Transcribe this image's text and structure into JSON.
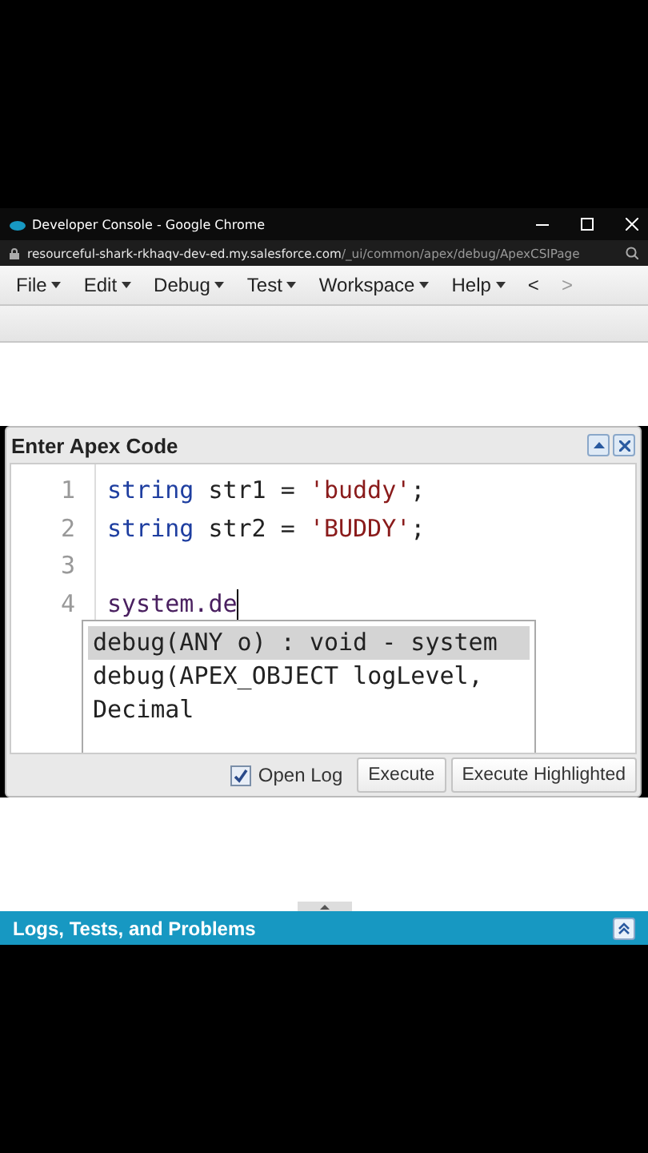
{
  "window": {
    "title": "Developer Console - Google Chrome"
  },
  "address_bar": {
    "host": "resourceful-shark-rkhaqv-dev-ed.my.salesforce.com",
    "path": "/_ui/common/apex/debug/ApexCSIPage"
  },
  "menu": [
    {
      "label": "File",
      "dropdown": true
    },
    {
      "label": "Edit",
      "dropdown": true
    },
    {
      "label": "Debug",
      "dropdown": true
    },
    {
      "label": "Test",
      "dropdown": true
    },
    {
      "label": "Workspace",
      "dropdown": true
    },
    {
      "label": "Help",
      "dropdown": true
    },
    {
      "label": "<",
      "disabled": false
    },
    {
      "label": ">",
      "disabled": true
    }
  ],
  "panel": {
    "title": "Enter Apex Code",
    "lines": [
      {
        "number": "1",
        "tokens": [
          {
            "kind": "keyword",
            "text": "string"
          },
          {
            "kind": "plain",
            "text": " str1 = "
          },
          {
            "kind": "string",
            "text": "'buddy'"
          },
          {
            "kind": "plain",
            "text": ";"
          }
        ]
      },
      {
        "number": "2",
        "tokens": [
          {
            "kind": "keyword",
            "text": "string"
          },
          {
            "kind": "plain",
            "text": " str2 = "
          },
          {
            "kind": "string",
            "text": "'BUDDY'"
          },
          {
            "kind": "plain",
            "text": ";"
          }
        ]
      },
      {
        "number": "3"
      },
      {
        "number": "4",
        "tokens": [
          {
            "kind": "identifier",
            "text": "system.de"
          }
        ]
      }
    ],
    "suggestions": [
      {
        "text": "debug(ANY o) : void - system",
        "selected": true
      },
      {
        "text": "debug(APEX_OBJECT logLevel,",
        "selected": false
      },
      {
        "text": "Decimal",
        "selected": false
      }
    ],
    "open_log": {
      "label": "Open Log",
      "checked": true
    },
    "buttons": [
      "Execute",
      "Execute Highlighted"
    ]
  },
  "bottom_panel": {
    "title": "Logs, Tests, and Problems"
  }
}
